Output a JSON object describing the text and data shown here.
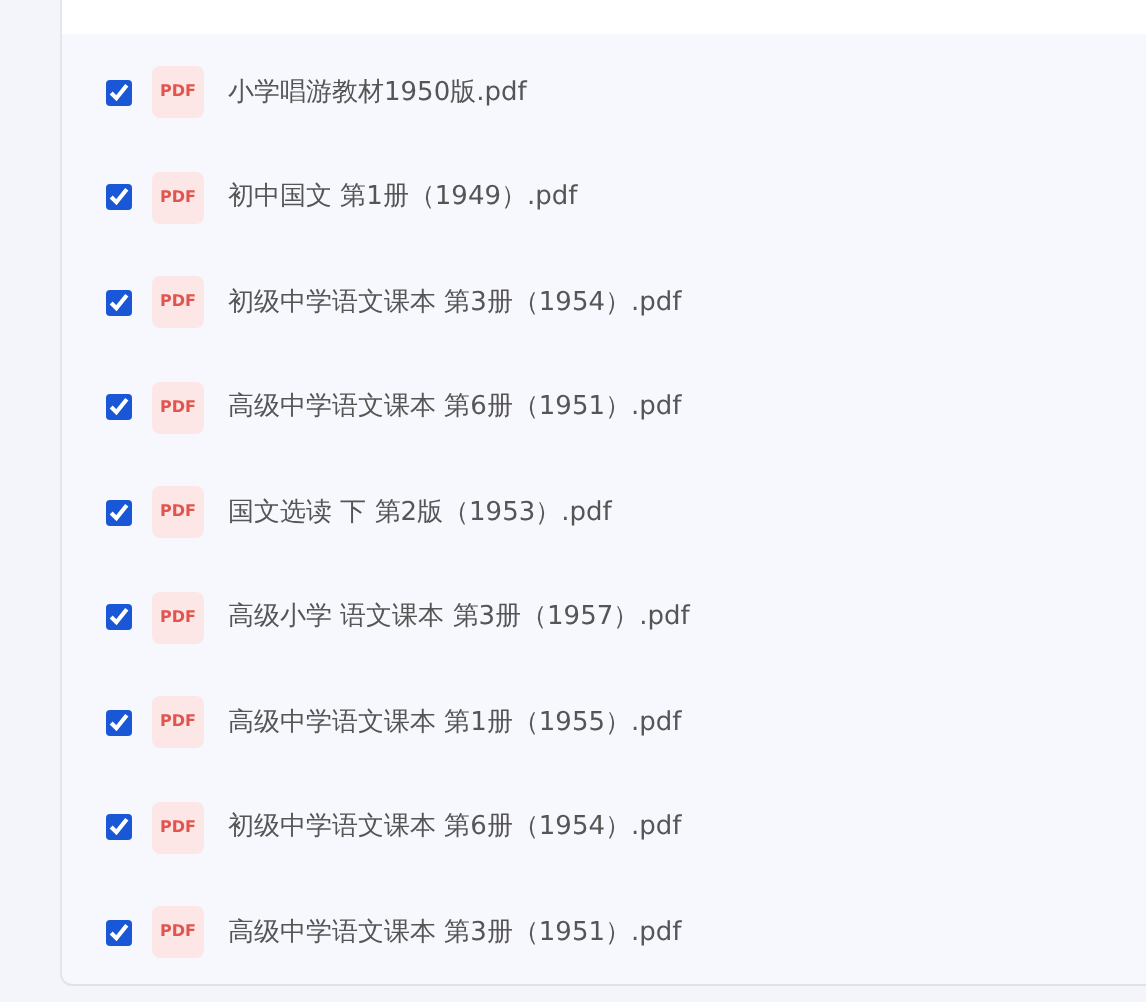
{
  "files": [
    {
      "name": "小学唱游教材1950版.pdf",
      "type_label": "PDF",
      "checked": true
    },
    {
      "name": "初中国文 第1册（1949）.pdf",
      "type_label": "PDF",
      "checked": true
    },
    {
      "name": "初级中学语文课本 第3册（1954）.pdf",
      "type_label": "PDF",
      "checked": true
    },
    {
      "name": "高级中学语文课本 第6册（1951）.pdf",
      "type_label": "PDF",
      "checked": true
    },
    {
      "name": "国文选读 下 第2版（1953）.pdf",
      "type_label": "PDF",
      "checked": true
    },
    {
      "name": "高级小学 语文课本 第3册（1957）.pdf",
      "type_label": "PDF",
      "checked": true
    },
    {
      "name": "高级中学语文课本 第1册（1955）.pdf",
      "type_label": "PDF",
      "checked": true
    },
    {
      "name": "初级中学语文课本 第6册（1954）.pdf",
      "type_label": "PDF",
      "checked": true
    },
    {
      "name": "高级中学语文课本 第3册（1951）.pdf",
      "type_label": "PDF",
      "checked": true
    }
  ]
}
